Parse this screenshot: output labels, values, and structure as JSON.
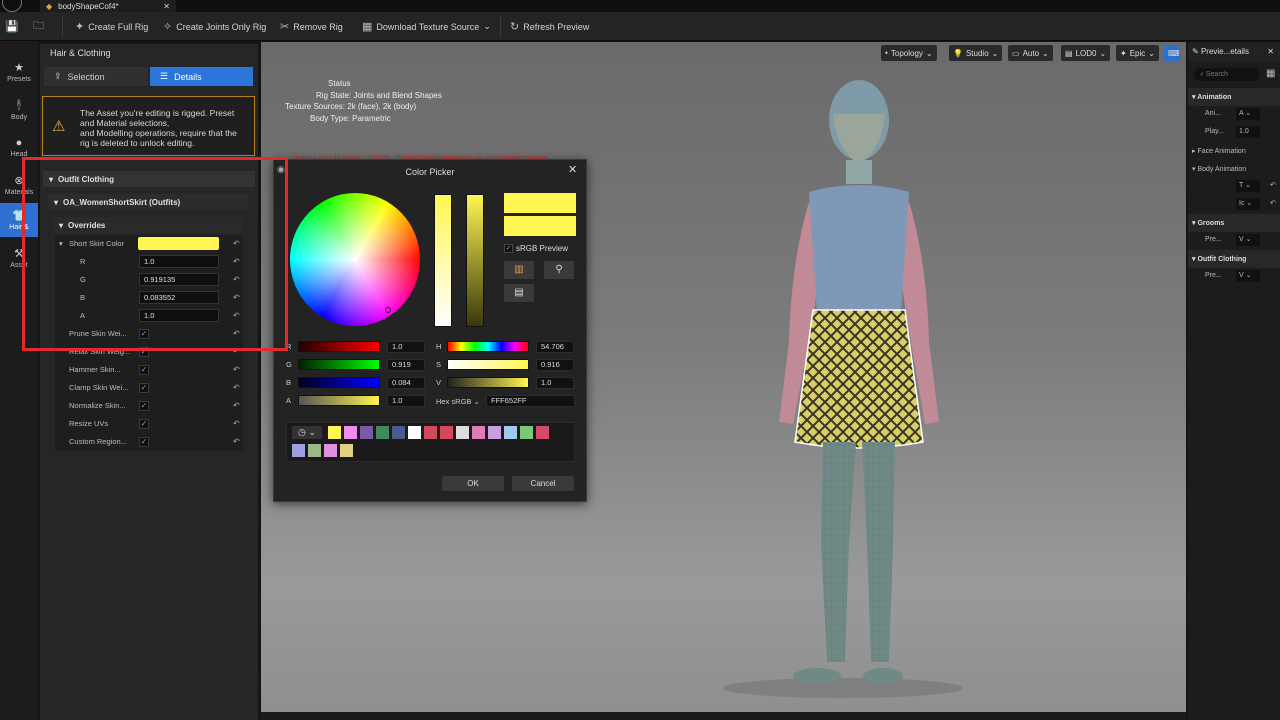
{
  "tab": {
    "title": "bodyShapeCof4*"
  },
  "toolbar": {
    "create_full_rig": "Create Full Rig",
    "create_joints_only_rig": "Create Joints Only Rig",
    "remove_rig": "Remove Rig",
    "download_texture_source": "Download Texture Source",
    "refresh_preview": "Refresh Preview"
  },
  "rail": {
    "items": [
      {
        "label": "Presets",
        "icon": "star-icon"
      },
      {
        "label": "Body",
        "icon": "body-icon"
      },
      {
        "label": "Head",
        "icon": "head-icon"
      },
      {
        "label": "Materials",
        "icon": "materials-icon"
      },
      {
        "label": "Hair &",
        "icon": "hair-icon"
      },
      {
        "label": "Asset",
        "icon": "hammer-icon"
      }
    ]
  },
  "panel": {
    "title": "Hair & Clothing",
    "selection_tab": "Selection",
    "details_tab": "Details",
    "warning": "The Asset you're editing is rigged. Preset\nand Material selections,\nand Modelling operations, require that the\nrig is deleted to unlock editing.",
    "outfit_section": "Outfit Clothing",
    "outfit_item": "OA_WomenShortSkirt (Outfits)",
    "overrides": "Overrides",
    "short_skirt_color": "Short Skirt Color",
    "skirt_color_hex": "#FFF652",
    "r_label": "R",
    "r_value": "1.0",
    "g_label": "G",
    "g_value": "0.919135",
    "b_label": "B",
    "b_value": "0.083552",
    "a_label": "A",
    "a_value": "1.0",
    "checkbox_rows": [
      "Prune Skin Wei...",
      "Relax Skin Weig...",
      "Hammer Skin...",
      "Clamp Skin Wei...",
      "Normalize Skin...",
      "Resize UVs",
      "Custom Region..."
    ]
  },
  "viewport": {
    "buttons": [
      "Topology",
      "Studio",
      "Auto",
      "LOD0",
      "Epic"
    ],
    "status_title": "Status",
    "rig_state": "Rig State: Joints and Blend Shapes",
    "texture_sources": "Texture Sources: 2k (face), 2k (body)",
    "body_type": "Body Type: Parametric",
    "warning_line": "...shapes should lower... (2023)...Expect performance to go out of performance."
  },
  "right_panel": {
    "title": "Previe...etails",
    "search_placeholder": "Search",
    "animation": "Animation",
    "ani_label": "Ani...",
    "ani_value": "A",
    "play_label": "Play...",
    "play_value": "1.0",
    "face_animation": "Face Animation",
    "body_animation": "Body Animation",
    "body_val1": "T",
    "body_val2": "Ic",
    "grooms": "Grooms",
    "grooms_pre": "Pre...",
    "grooms_val": "V",
    "outfit_clothing": "Outfit Clothing",
    "outfit_pre": "Pre...",
    "outfit_val": "V"
  },
  "color_picker": {
    "title": "Color Picker",
    "srgb_preview": "sRGB Preview",
    "r_value": "1.0",
    "g_value": "0.919",
    "b_value": "0.084",
    "a_value": "1.0",
    "r_label": "R",
    "g_label": "G",
    "b_label": "B",
    "a_label": "A",
    "h_label": "H",
    "s_label": "S",
    "v_label": "V",
    "h_value": "54.706",
    "s_value": "0.916",
    "v_value": "1.0",
    "hex_label": "Hex sRGB",
    "hex_value": "FFF652FF",
    "ok": "OK",
    "cancel": "Cancel",
    "swatches": [
      "#fff652",
      "#f08cf0",
      "#7b5aa6",
      "#3f8a5c",
      "#4a5a8a",
      "#ffffff",
      "#d24a5a",
      "#d4485a",
      "#dddddd",
      "#e07ab8",
      "#c8a0e0",
      "#a0c8f0",
      "#7ac87a",
      "#d44a6a",
      "#a0a0e0",
      "#9ab88a",
      "#e090e0",
      "#e0d080"
    ]
  }
}
